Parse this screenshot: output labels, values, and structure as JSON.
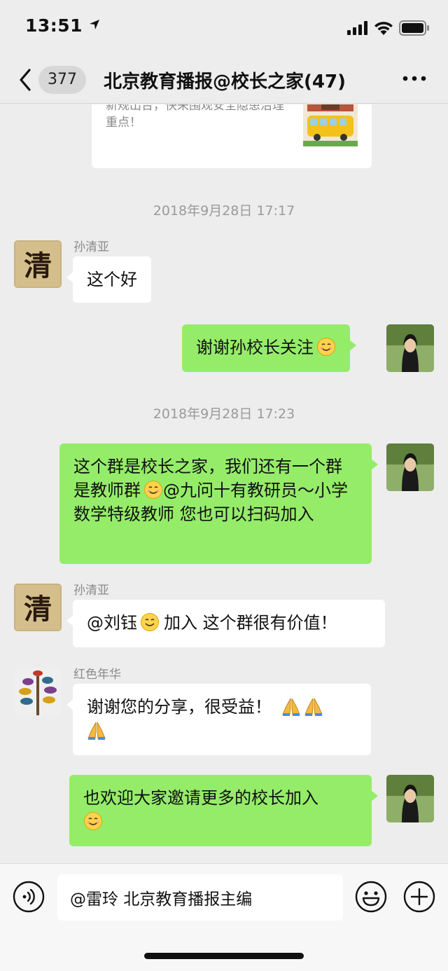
{
  "status_bar": {
    "time": "13:51"
  },
  "header": {
    "back_badge": "377",
    "title": "北京教育播报@校长之家(47)"
  },
  "share_card": {
    "text": "新规出台，快来围观安全隐患治理重点！"
  },
  "timestamps": [
    "2018年9月28日 17:17",
    "2018年9月28日 17:23"
  ],
  "messages": [
    {
      "direction": "in",
      "sender": "孙清亚",
      "avatar_char": "清",
      "text": "这个好"
    },
    {
      "direction": "out",
      "text": "谢谢孙校长关注"
    },
    {
      "direction": "out",
      "text_parts": [
        "这个群是校长之家，我们还有一个群是教师群",
        "@九问十有教研员～小学数学特级教师  您也可以扫码加入"
      ]
    },
    {
      "direction": "in",
      "sender": "孙清亚",
      "avatar_char": "清",
      "text_parts": [
        "@刘钰",
        "加入 这个群很有价值！"
      ]
    },
    {
      "direction": "in",
      "sender": "红色年华",
      "text": "谢谢您的分享，很受益！"
    },
    {
      "direction": "out",
      "text": "也欢迎大家邀请更多的校长加入"
    }
  ],
  "input": {
    "value": "@雷玲 北京教育播报主编"
  },
  "icons": {
    "back": "chevron-left-icon",
    "more": "more-dots-icon",
    "voice": "voice-icon",
    "emoji": "emoji-icon",
    "plus": "plus-icon",
    "smile": "smile-emoji",
    "pray": "pray-emoji"
  },
  "colors": {
    "background": "#ededed",
    "bubble_out": "#95ec69",
    "bubble_in": "#ffffff"
  }
}
